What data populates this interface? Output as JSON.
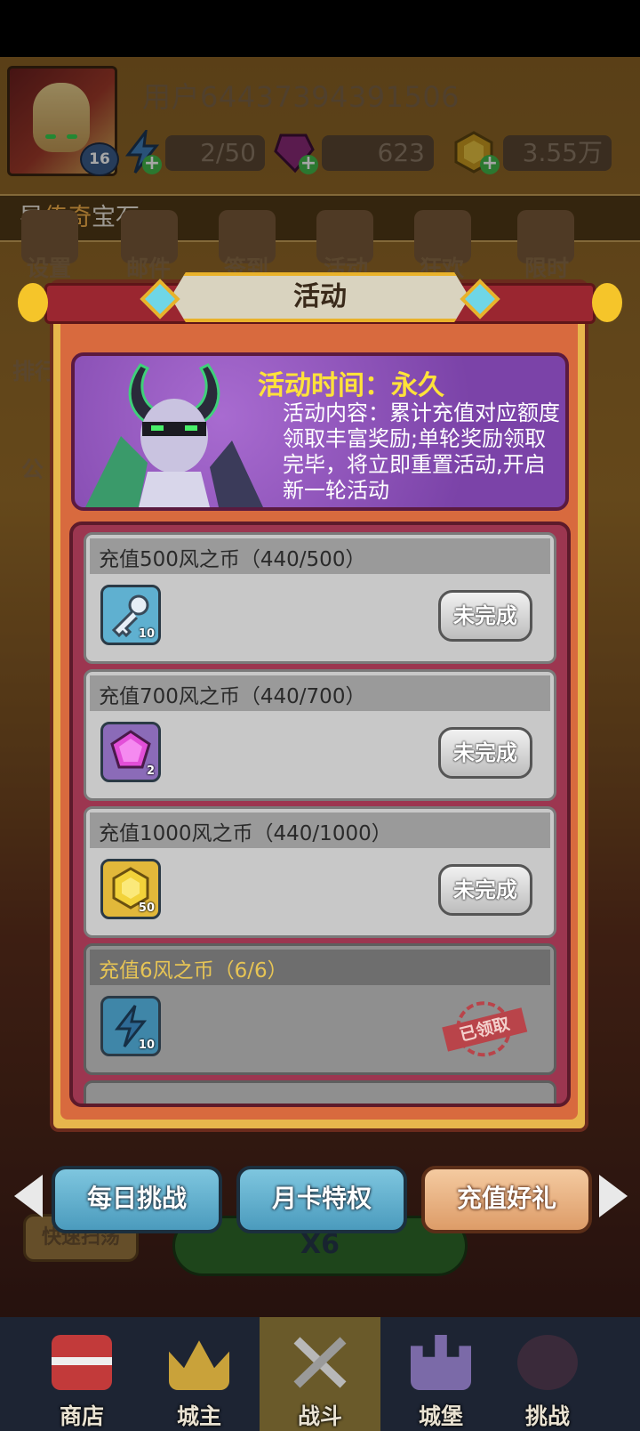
{
  "player": {
    "username": "用户64437394391506",
    "level": "16",
    "energy": "2/50",
    "gems": "623",
    "gold": "3.55万"
  },
  "guide": {
    "prefix": "导",
    "highlight": "传奇",
    "suffix": "宝石"
  },
  "menu": [
    "设置",
    "邮件",
    "签到",
    "活动",
    "狂欢",
    "限时"
  ],
  "side_menu": [
    "排行",
    "公"
  ],
  "modal": {
    "title": "活动",
    "activity_time": "活动时间：永久",
    "activity_content": "活动内容：累计充值对应额度领取丰富奖励;单轮奖励领取完毕，将立即重置活动,开启新一轮活动"
  },
  "tasks": [
    {
      "title": "充值500风之币（440/500）",
      "reward_icon": "key-icon",
      "reward_count": "10",
      "status": "未完成"
    },
    {
      "title": "充值700风之币（440/700）",
      "reward_icon": "purple-gem-icon",
      "reward_count": "2",
      "status": "未完成"
    },
    {
      "title": "充值1000风之币（440/1000）",
      "reward_icon": "gold-coin-icon",
      "reward_count": "50",
      "status": "未完成"
    },
    {
      "title": "充值6风之币（6/6）",
      "reward_icon": "energy-icon",
      "reward_count": "10",
      "status": "已领取"
    }
  ],
  "tabs": [
    {
      "label": "每日挑战",
      "active": false
    },
    {
      "label": "月卡特权",
      "active": false
    },
    {
      "label": "充值好礼",
      "active": true
    }
  ],
  "behind": {
    "quick_sweep": "快速扫荡",
    "battle_multiplier": "X6"
  },
  "bottom_nav": [
    "商店",
    "城主",
    "战斗",
    "城堡",
    "挑战"
  ],
  "colors": {
    "accent_gold": "#e9b22a",
    "highlight_yellow": "#ffe23a",
    "guide_highlight": "#f7b24a"
  }
}
